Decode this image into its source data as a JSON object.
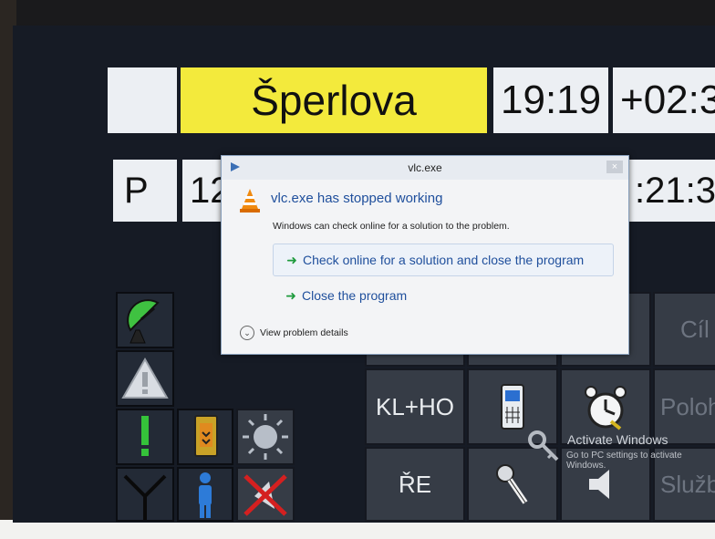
{
  "display": {
    "station_name": "Šperlova",
    "time": "19:19",
    "offset": "+02:3",
    "row2_letter": "P",
    "row2_num": "12",
    "row2_right": ":21:3",
    "buttons": {
      "cil": "Cíl",
      "klho": "KL+HO",
      "poloha": "Poloha",
      "re": "ŘE",
      "sluzba": "Služba"
    }
  },
  "dialog": {
    "title": "vlc.exe",
    "close": "×",
    "heading": "vlc.exe has stopped working",
    "subtext": "Windows can check online for a solution to the problem.",
    "option1": "Check online for a solution and close the program",
    "option2": "Close the program",
    "details": "View problem details"
  },
  "watermark": {
    "line1": "Activate Windows",
    "line2": "Go to PC settings to activate",
    "line3": "Windows."
  },
  "colors": {
    "yellow": "#f3ea3c",
    "link": "#1f4f9c",
    "arrow": "#1e9a3c"
  }
}
